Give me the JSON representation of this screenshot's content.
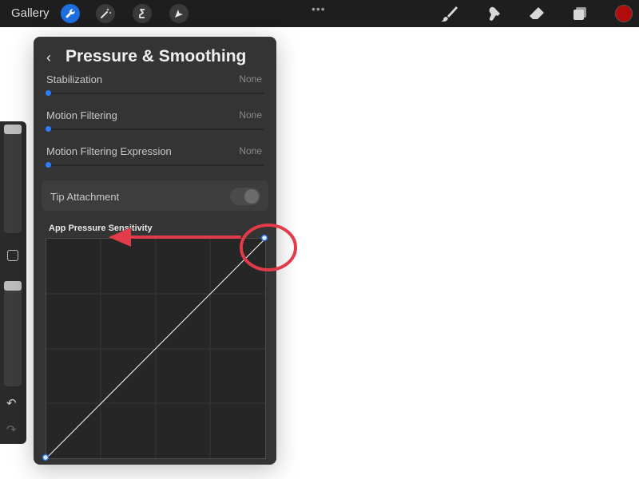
{
  "topbar": {
    "gallery_label": "Gallery",
    "tools": [
      {
        "name": "actions",
        "icon": "wrench-icon",
        "active": true
      },
      {
        "name": "adjustments",
        "icon": "magic-wand-icon",
        "active": false
      },
      {
        "name": "selection",
        "icon": "selection-s-icon",
        "active": false
      },
      {
        "name": "transform",
        "icon": "arrow-cursor-icon",
        "active": false
      }
    ],
    "more_icon": "•••",
    "right_tools": [
      "brush-icon",
      "smudge-icon",
      "eraser-icon",
      "layers-icon"
    ],
    "current_color": "#b00c0c",
    "active_color": "#1d6fe0"
  },
  "sidebar": {
    "undo_glyph": "↶",
    "redo_glyph": "↷",
    "brush_size_level": 0.0,
    "opacity_level": 0.0
  },
  "panel": {
    "back_glyph": "‹",
    "title": "Pressure & Smoothing",
    "rows": [
      {
        "label": "Stabilization",
        "value": "None",
        "level": 0
      },
      {
        "label": "Motion Filtering",
        "value": "None",
        "level": 0
      },
      {
        "label": "Motion Filtering Expression",
        "value": "None",
        "level": 0
      }
    ],
    "tip_attachment": {
      "label": "Tip Attachment",
      "enabled": false
    },
    "graph_title": "App Pressure Sensitivity",
    "curve": {
      "start": [
        0,
        0
      ],
      "end": [
        1,
        1
      ]
    }
  },
  "annotation": {
    "color": "#e23b4a"
  }
}
